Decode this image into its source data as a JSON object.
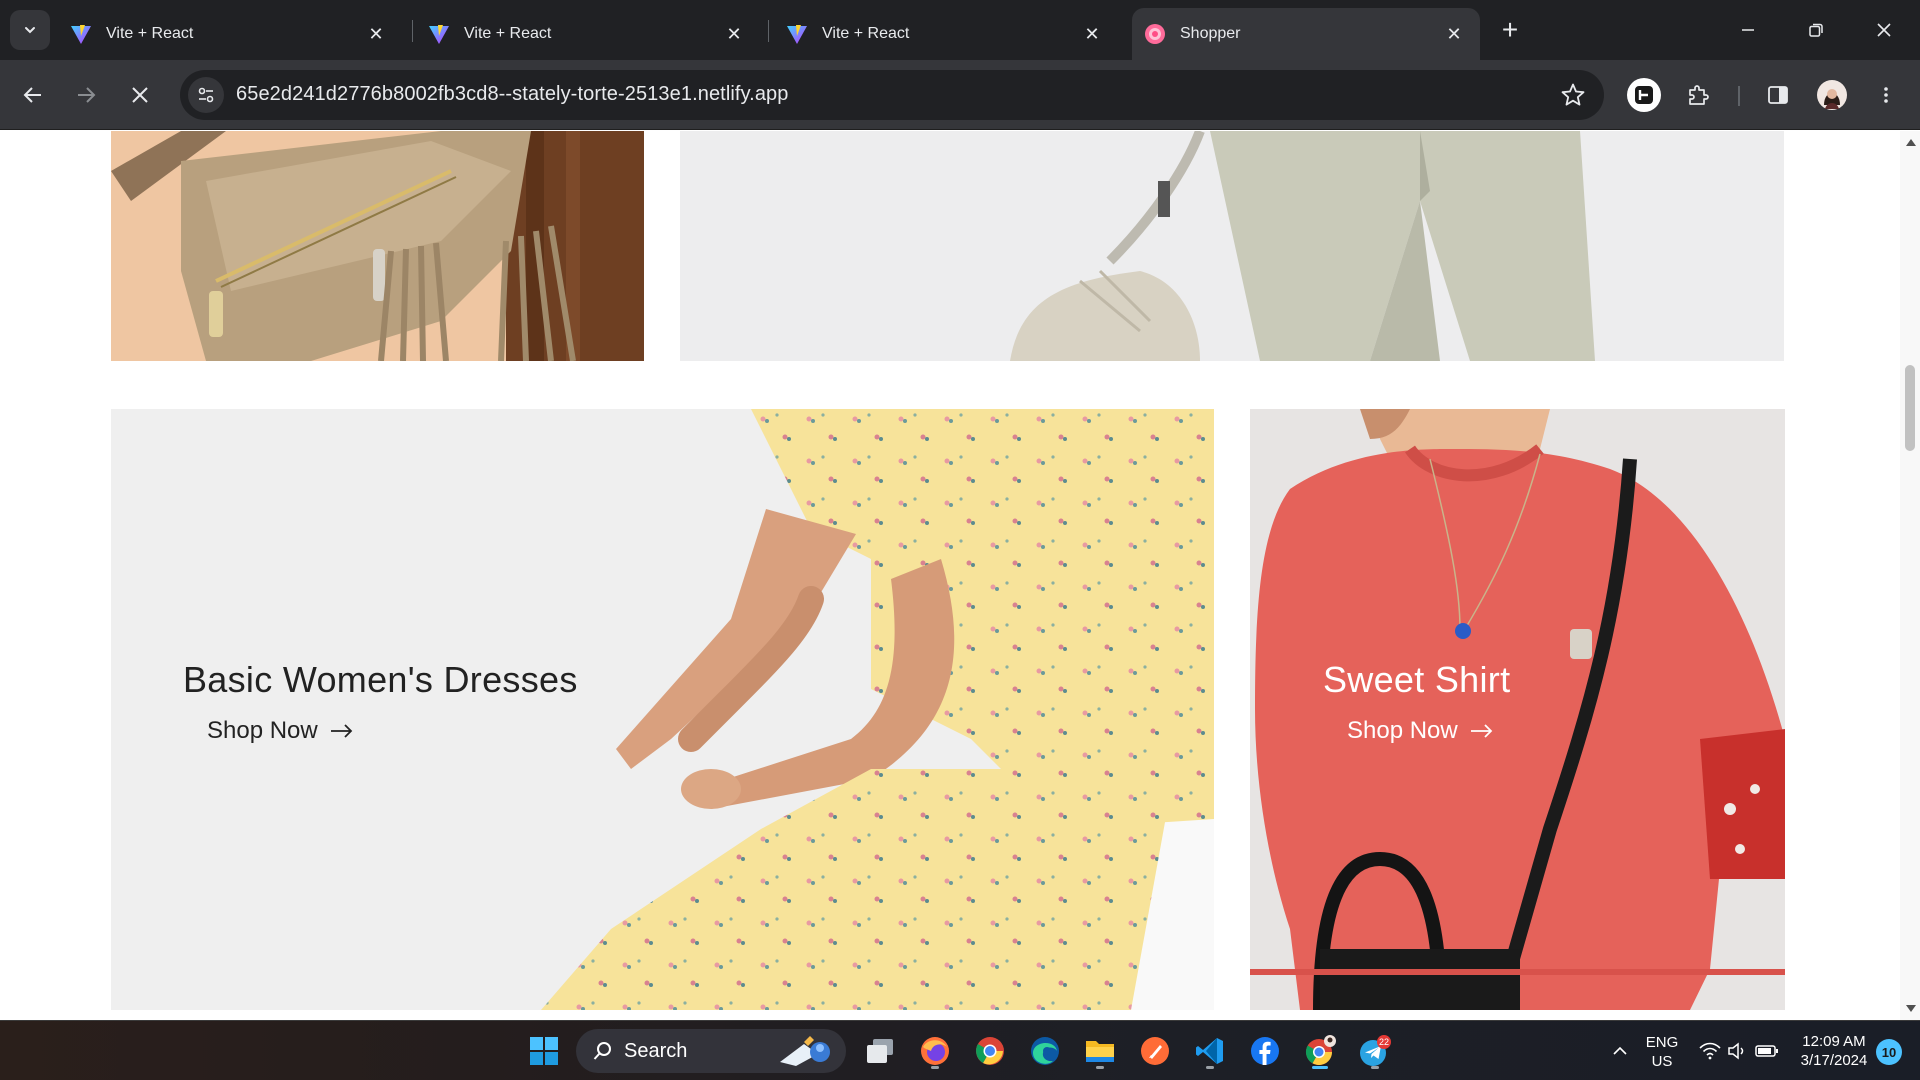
{
  "browser": {
    "tabs": [
      {
        "title": "Vite + React",
        "active": false,
        "favicon": "vite-icon"
      },
      {
        "title": "Vite + React",
        "active": false,
        "favicon": "vite-icon"
      },
      {
        "title": "Vite + React",
        "active": false,
        "favicon": "vite-icon"
      },
      {
        "title": "Shopper",
        "active": true,
        "favicon": "shopper-icon"
      }
    ],
    "url": "65e2d241d2776b8002fb3cd8--stately-torte-2513e1.netlify.app",
    "theme": {
      "frame": "#202124",
      "toolbar": "#35363a",
      "text": "#e8eaed"
    }
  },
  "page": {
    "cards": [
      {
        "id": "bag",
        "title": "",
        "link": ""
      },
      {
        "id": "pants",
        "title": "",
        "link": ""
      },
      {
        "id": "dress",
        "title": "Basic Women's Dresses",
        "link": "Shop Now",
        "text_color": "#222222"
      },
      {
        "id": "shirt",
        "title": "Sweet Shirt",
        "link": "Shop Now",
        "text_color": "#ffffff"
      }
    ]
  },
  "taskbar": {
    "search_label": "Search",
    "apps": [
      "start-icon",
      "search-icon",
      "task-view-icon",
      "firefox-icon",
      "chrome-icon",
      "edge-icon",
      "file-explorer-icon",
      "postman-icon",
      "vscode-icon",
      "facebook-icon",
      "chrome-profile-icon",
      "telegram-icon"
    ],
    "telegram_badge": "22",
    "language": {
      "line1": "ENG",
      "line2": "US"
    },
    "clock": {
      "time": "12:09 AM",
      "date": "3/17/2024"
    },
    "notification_count": "10"
  }
}
